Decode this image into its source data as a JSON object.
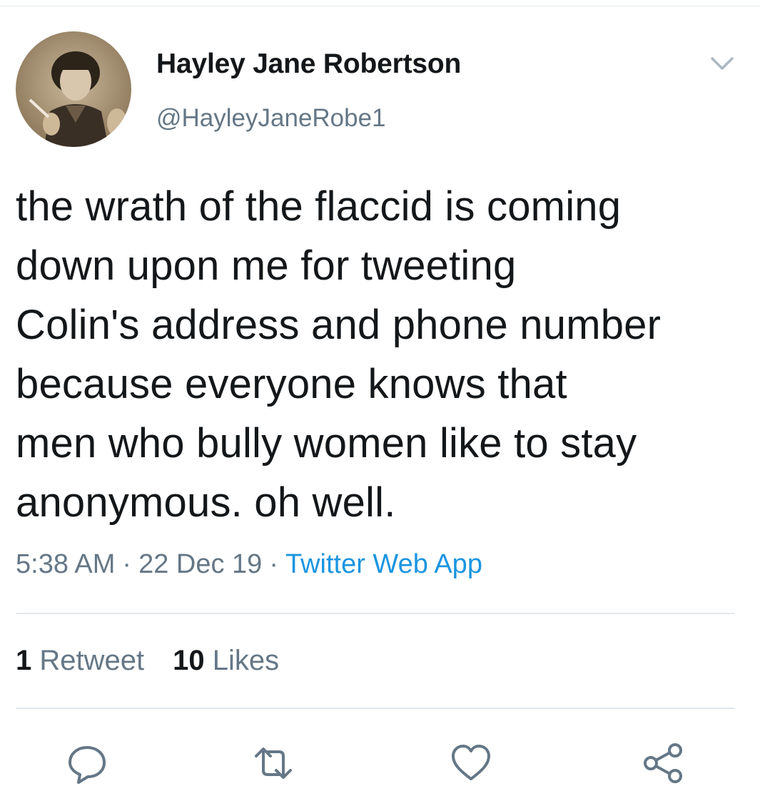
{
  "tweet": {
    "display_name": "Hayley Jane Robertson",
    "handle": "@HayleyJaneRobe1",
    "text_lines": [
      "the wrath of the flaccid is coming",
      "down upon me for tweeting",
      "Colin's address and phone number",
      "because everyone knows that",
      "men who bully women like to stay",
      "anonymous. oh well."
    ],
    "time": "5:38 AM",
    "separator": "·",
    "date": "22 Dec 19",
    "source": "Twitter Web App"
  },
  "stats": {
    "retweet_count": "1",
    "retweet_label": "Retweet",
    "like_count": "10",
    "like_label": "Likes"
  },
  "icons": {
    "menu": "chevron-down-icon",
    "reply": "reply-icon",
    "retweet": "retweet-icon",
    "like": "heart-icon",
    "share": "share-icon"
  },
  "colors": {
    "text": "#14171a",
    "secondary": "#657786",
    "link": "#1b95e0",
    "divider": "#e1e8ed"
  }
}
